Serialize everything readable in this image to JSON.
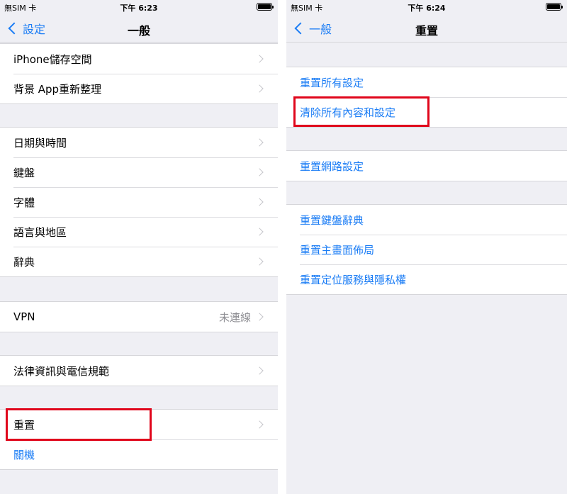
{
  "left": {
    "status": {
      "carrier": "無SIM 卡",
      "time": "下午 6:23"
    },
    "nav": {
      "back_label": "設定",
      "title": "一般"
    },
    "groups": [
      {
        "items": [
          "iPhone儲存空間",
          "背景 App重新整理"
        ]
      },
      {
        "items": [
          "日期與時間",
          "鍵盤",
          "字體",
          "語言與地區",
          "辭典"
        ]
      },
      {
        "items": [
          "VPN"
        ],
        "vpn_value": "未連線"
      },
      {
        "items": [
          "法律資訊與電信規範"
        ]
      },
      {
        "items": [
          "重置",
          "關機"
        ]
      }
    ]
  },
  "right": {
    "status": {
      "carrier": "無SIM 卡",
      "time": "下午 6:24"
    },
    "nav": {
      "back_label": "一般",
      "title": "重置"
    },
    "groups": [
      {
        "items": [
          "重置所有設定",
          "清除所有內容和設定"
        ]
      },
      {
        "items": [
          "重置網路設定"
        ]
      },
      {
        "items": [
          "重置鍵盤辭典",
          "重置主畫面佈局",
          "重置定位服務與隱私權"
        ]
      }
    ]
  },
  "colors": {
    "accent": "#1a7cf5",
    "highlight": "#e0061b",
    "background": "#efeff4"
  },
  "icons": [
    "back-chevron-icon",
    "disclosure-chevron-icon",
    "battery-icon"
  ]
}
